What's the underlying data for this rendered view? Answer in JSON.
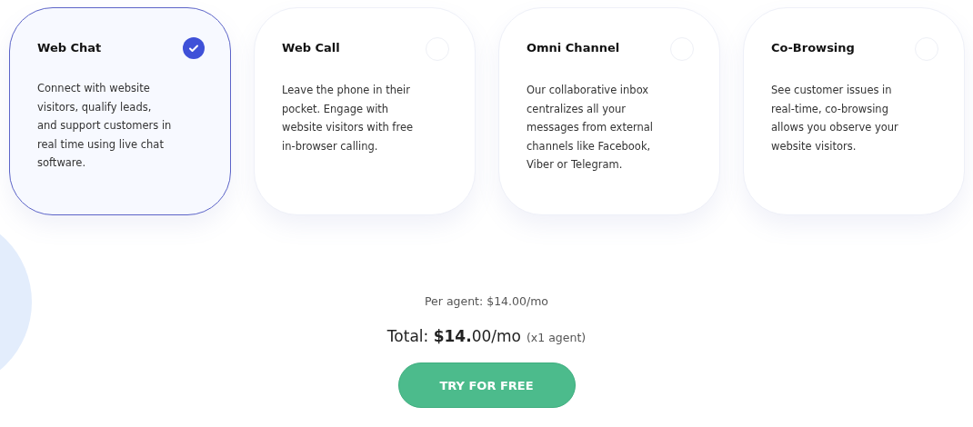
{
  "plans": [
    {
      "title": "Web Chat",
      "selected": true,
      "description": "Connect with website visitors, qualify leads, and support customers in real time using live chat software."
    },
    {
      "title": "Web Call",
      "selected": false,
      "description": "Leave the phone in their pocket. Engage with website visitors with free in-browser calling."
    },
    {
      "title": "Omni Channel",
      "selected": false,
      "description": "Our collaborative inbox centralizes all your messages from external channels like Facebook, Viber or Telegram."
    },
    {
      "title": "Co-Browsing",
      "selected": false,
      "description": "See customer issues in real-time, co-browsing allows you observe your website visitors."
    }
  ],
  "pricing": {
    "per_agent": "Per agent: $14.00/mo",
    "total": "Total: **$14.**00/mo",
    "agents": "(x1 agent)"
  },
  "cta": "TRY FOR FREE"
}
